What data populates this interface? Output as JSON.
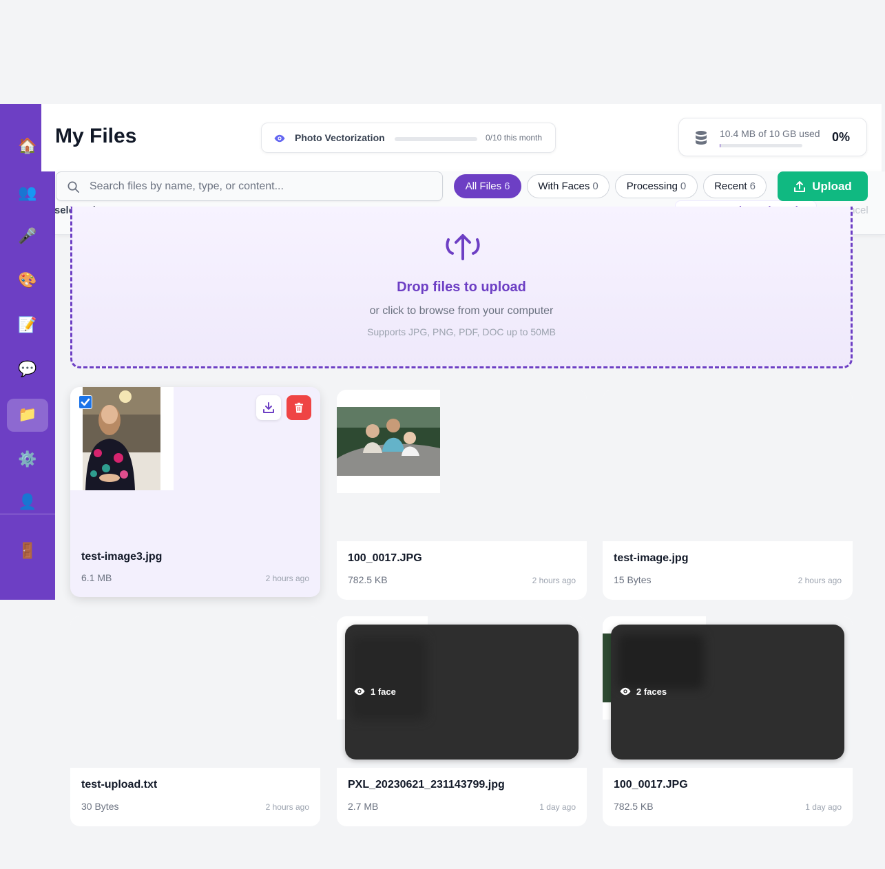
{
  "sidebar": {
    "items": [
      {
        "name": "home",
        "icon": "home-icon",
        "glyph": "🏠"
      },
      {
        "name": "people",
        "icon": "people-icon",
        "glyph": "👥"
      },
      {
        "name": "voice",
        "icon": "microphone-icon",
        "glyph": "🎤"
      },
      {
        "name": "art",
        "icon": "palette-icon",
        "glyph": "🎨"
      },
      {
        "name": "notes",
        "icon": "memo-icon",
        "glyph": "📝"
      },
      {
        "name": "chat",
        "icon": "speech-bubble-icon",
        "glyph": "💬"
      },
      {
        "name": "files",
        "icon": "folder-icon",
        "glyph": "📁",
        "active": true
      },
      {
        "name": "settings",
        "icon": "gear-icon",
        "glyph": "⚙️"
      },
      {
        "name": "profile",
        "icon": "user-icon",
        "glyph": "👤"
      },
      {
        "name": "logout",
        "icon": "door-icon",
        "glyph": "🚪"
      }
    ]
  },
  "header": {
    "title": "My Files",
    "quota": {
      "label": "Photo Vectorization",
      "count": "0/10 this month",
      "progress": 0
    },
    "storage": {
      "text": "10.4 MB of 10 GB used",
      "percent": "0%",
      "progress": 0.001
    }
  },
  "selection_bar": {
    "text": "es selected",
    "vectorize_label": "Vectorize Selected",
    "cancel_label": "Cancel"
  },
  "search": {
    "placeholder": "Search files by name, type, or content...",
    "value": ""
  },
  "filters": [
    {
      "label": "All Files",
      "count": "6",
      "active": true
    },
    {
      "label": "With Faces",
      "count": "0"
    },
    {
      "label": "Processing",
      "count": "0"
    },
    {
      "label": "Recent",
      "count": "6"
    }
  ],
  "upload_label": "Upload",
  "dropzone": {
    "title": "Drop files to upload",
    "subtitle": "or click to browse from your computer",
    "note": "Supports JPG, PNG, PDF, DOC up to 50MB"
  },
  "files": [
    {
      "name": "test-image3.jpg",
      "size": "6.1 MB",
      "time": "2 hours ago",
      "selected": true
    },
    {
      "name": "100_0017.JPG",
      "size": "782.5 KB",
      "time": "2 hours ago"
    },
    {
      "name": "test-image.jpg",
      "size": "15 Bytes",
      "time": "2 hours ago"
    },
    {
      "name": "test-upload.txt",
      "size": "30 Bytes",
      "time": "2 hours ago"
    },
    {
      "name": "PXL_20230621_231143799.jpg",
      "size": "2.7 MB",
      "time": "1 day ago",
      "faces": "1 face"
    },
    {
      "name": "100_0017.JPG",
      "size": "782.5 KB",
      "time": "1 day ago",
      "faces": "2 faces"
    }
  ],
  "colors": {
    "accent": "#6d3fc4",
    "upload": "#10b981",
    "delete": "#ef4444",
    "sidebar": "#6d3fc4"
  }
}
